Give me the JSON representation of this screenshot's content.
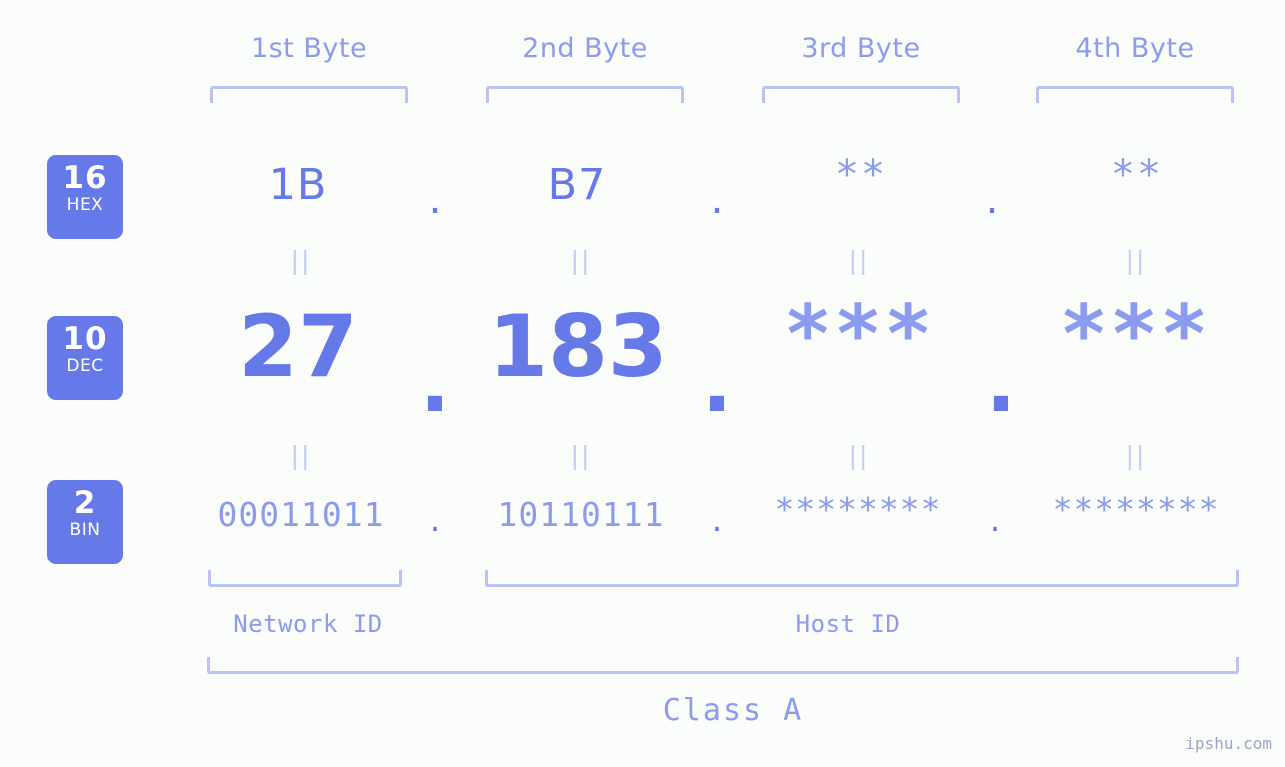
{
  "headers": [
    {
      "label": "1st Byte"
    },
    {
      "label": "2nd Byte"
    },
    {
      "label": "3rd Byte"
    },
    {
      "label": "4th Byte"
    }
  ],
  "radix": [
    {
      "number": "16",
      "name": "HEX"
    },
    {
      "number": "10",
      "name": "DEC"
    },
    {
      "number": "2",
      "name": "BIN"
    }
  ],
  "rows": {
    "hex": [
      "1B",
      "B7",
      "**",
      "**"
    ],
    "dec": [
      "27",
      "183",
      "***",
      "***"
    ],
    "bin": [
      "00011011",
      "10110111",
      "********",
      "********"
    ]
  },
  "separators": {
    "dot": ".",
    "equals": "||"
  },
  "labels": {
    "network_id": "Network ID",
    "host_id": "Host ID",
    "class": "Class A"
  },
  "watermark": "ipshu.com",
  "colors": {
    "accent": "#6679e8",
    "light_accent": "#8a9bf0",
    "bracket": "#b9c4f5",
    "background": "#fbfdfb",
    "badge_text": "#ffffff"
  }
}
